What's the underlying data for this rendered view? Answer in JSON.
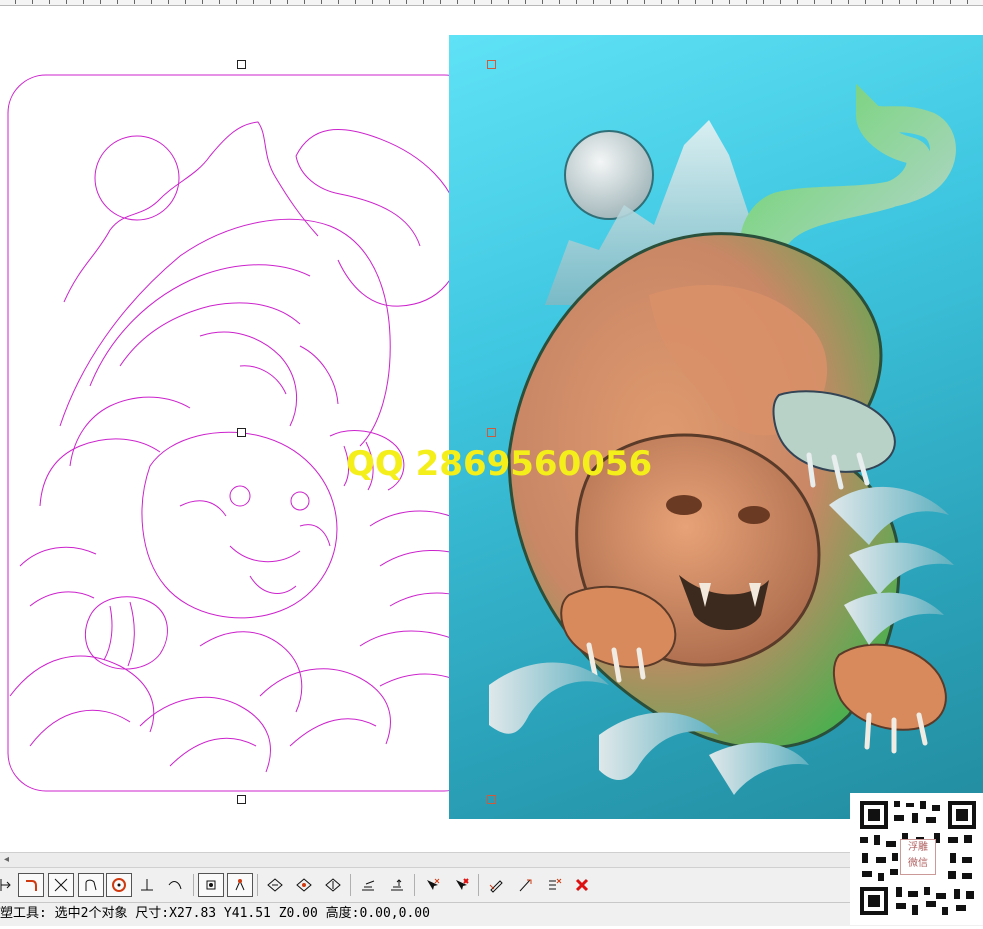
{
  "watermark": {
    "text": "QQ 2869560056"
  },
  "status_bar": {
    "text": "塑工具: 选中2个对象 尺寸:X27.83 Y41.51 Z0.00 高度:0.00,0.00"
  },
  "qr_badge": {
    "line1": "浮雕",
    "line2": "微信"
  },
  "toolbar": {
    "buttons": [
      "move-icon",
      "fillet-icon",
      "trim-icon",
      "arc-corner-icon",
      "circle-target-icon",
      "perpendicular-icon",
      "tangent-arc-icon",
      "node-select-icon",
      "node-edit-icon",
      "diamond-add-icon",
      "diamond-edit-icon",
      "diamond-remove-icon",
      "stack-align-icon",
      "stack-align-alt-icon",
      "pointer-plus-icon",
      "pointer-delete-icon",
      "pen-edit-icon",
      "pen-join-icon",
      "list-edit-icon",
      "close-icon"
    ]
  },
  "colors": {
    "accent": "#cc22cc",
    "relief_bg": "#3fc6e0",
    "watermark": "#f4ee1a",
    "tiger_orange": "#d98a5c",
    "tiger_green": "#5fbf5f",
    "delete_red": "#dd1111"
  }
}
